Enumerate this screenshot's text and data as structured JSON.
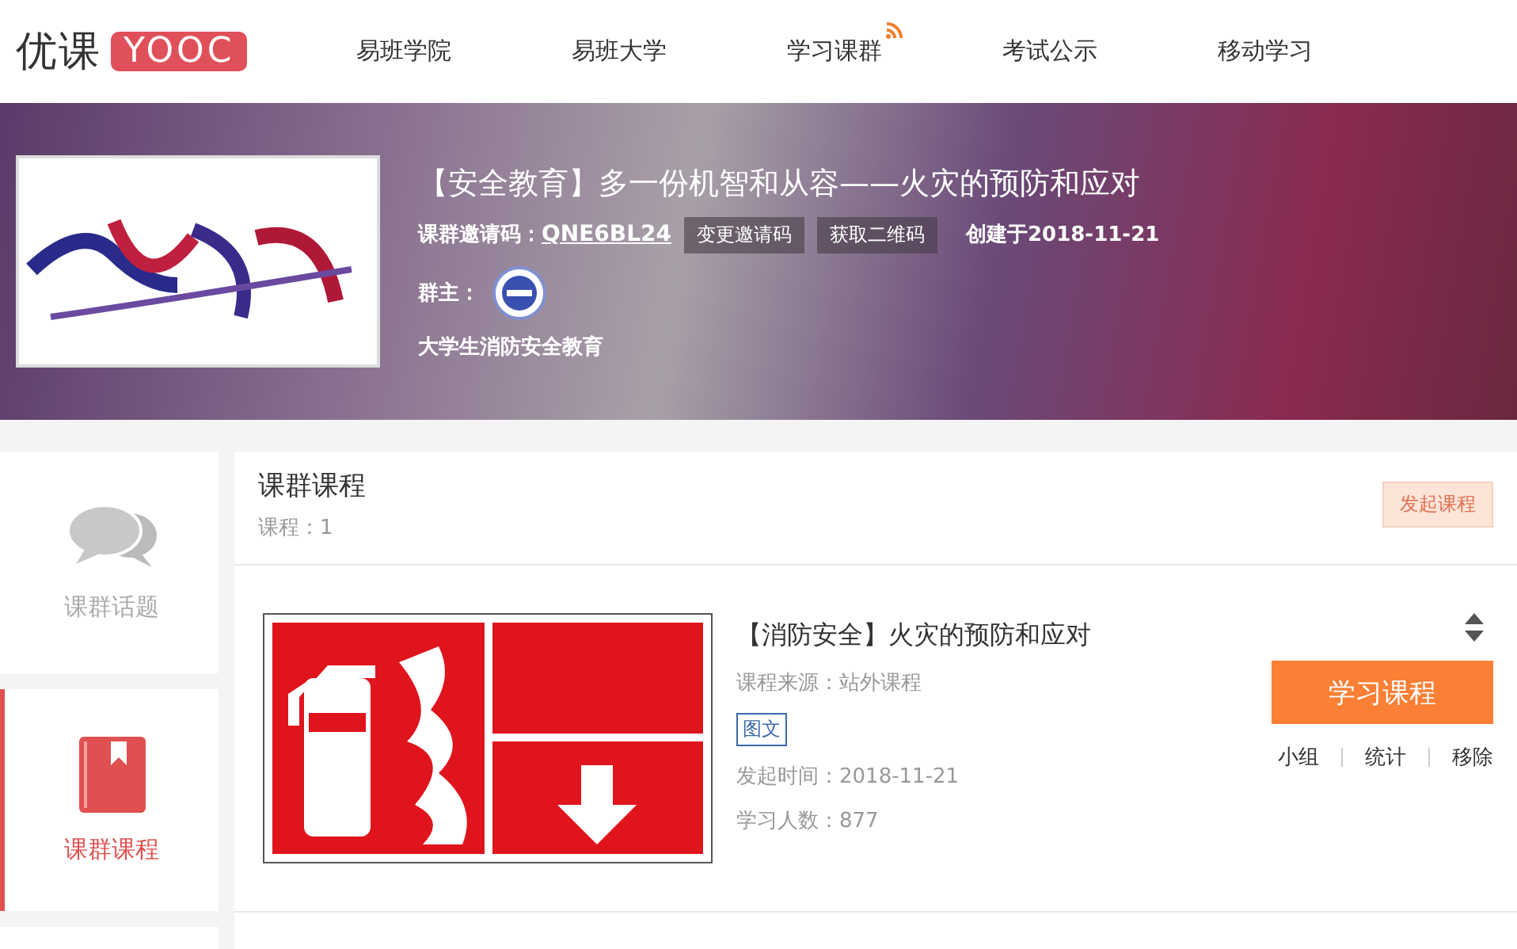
{
  "header": {
    "logo_text": "优课",
    "logo_badge": "YOOC",
    "nav": [
      {
        "label": "易班学院",
        "feed": false
      },
      {
        "label": "易班大学",
        "feed": false
      },
      {
        "label": "学习课群",
        "feed": true
      },
      {
        "label": "考试公示",
        "feed": false
      },
      {
        "label": "移动学习",
        "feed": false
      }
    ]
  },
  "banner": {
    "cover": {
      "kind": "picture"
    },
    "title": "【安全教育】多一份机智和从容——火灾的预防和应对",
    "invite_label": "课群邀请码：",
    "invite_code": "QNE6BL24",
    "buttons": [
      "变更邀请码",
      "获取二维码"
    ],
    "created": "创建于2018-11-21",
    "owner_label": "群主：",
    "description": "大学生消防安全教育"
  },
  "sidebar": {
    "items": [
      {
        "label": "课群话题",
        "kind": "topics",
        "selected": false
      },
      {
        "label": "课群课程",
        "kind": "courses",
        "selected": true
      }
    ]
  },
  "panel": {
    "title": "课群课程",
    "count": "课程：1",
    "action": "发起课程"
  },
  "courses": [
    {
      "cover": {
        "kind": "picture"
      },
      "title": "【消防安全】火灾的预防和应对",
      "source": "课程来源：站外课程",
      "tag": "图文",
      "date": "发起时间：2018-11-21",
      "learners": "学习人数：877",
      "study_button": "学习课程",
      "links": [
        "小组",
        "统计",
        "移除"
      ]
    }
  ]
}
